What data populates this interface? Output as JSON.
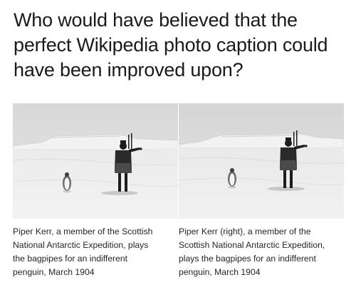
{
  "headline": "Who would have believed that the\nperfect Wikipedia photo caption could\nhave been improved upon?",
  "panels": [
    {
      "caption": "Piper Kerr, a member of the Scottish\nNational Antarctic Expedition, plays\nthe bagpipes for an indifferent\npenguin, March 1904"
    },
    {
      "caption": "Piper Kerr (right), a member of the\nScottish National Antarctic Expedition,\nplays the bagpipes for an indifferent\npenguin, March 1904"
    }
  ],
  "photo": {
    "alt_subject": "piper and penguin on ice"
  }
}
